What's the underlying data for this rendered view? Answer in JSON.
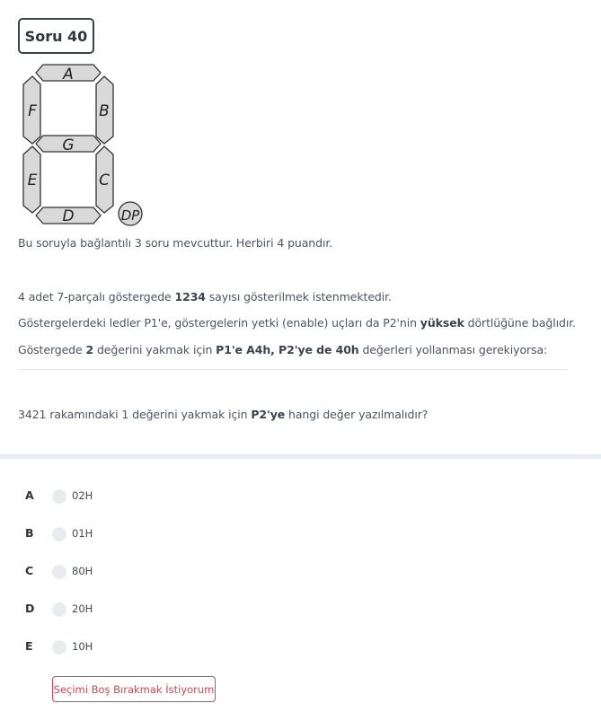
{
  "question": {
    "badge": "Soru 40",
    "display": {
      "segments": [
        "A",
        "B",
        "C",
        "D",
        "E",
        "F",
        "G"
      ],
      "dp_label": "DP"
    },
    "intro": "Bu soruyla bağlantılı 3 soru mevcuttur. Herbiri 4 puandır.",
    "p1": {
      "a": "4 adet 7-parçalı göstergede ",
      "b": "1234",
      "c": " sayısı gösterilmek istenmektedir."
    },
    "p2": {
      "a": "Göstergelerdeki ledler P1'e, göstergelerin yetki (enable) uçları da P2'nin ",
      "b": "yüksek",
      "c": " dörtlüğüne bağlıdır."
    },
    "p3": {
      "a": "Göstergede ",
      "b": "2",
      "c": " değerini yakmak için ",
      "d": "P1'e A4h, P2'ye de 40h",
      "e": " değerleri yollanması gerekiyorsa:"
    },
    "ask": {
      "a": "3421 rakamındaki 1 değerini yakmak için ",
      "b": "P2'ye",
      "c": " hangi değer yazılmalıdır?"
    }
  },
  "options": [
    {
      "letter": "A",
      "value": "02H"
    },
    {
      "letter": "B",
      "value": "01H"
    },
    {
      "letter": "C",
      "value": "80H"
    },
    {
      "letter": "D",
      "value": "20H"
    },
    {
      "letter": "E",
      "value": "10H"
    }
  ],
  "clear_button": "Seçimi Boş Bırakmak İstiyorum",
  "colors": {
    "accent_red": "#e0434f",
    "segment_fill": "#d9d9d9",
    "band": "#e6ebf4"
  }
}
